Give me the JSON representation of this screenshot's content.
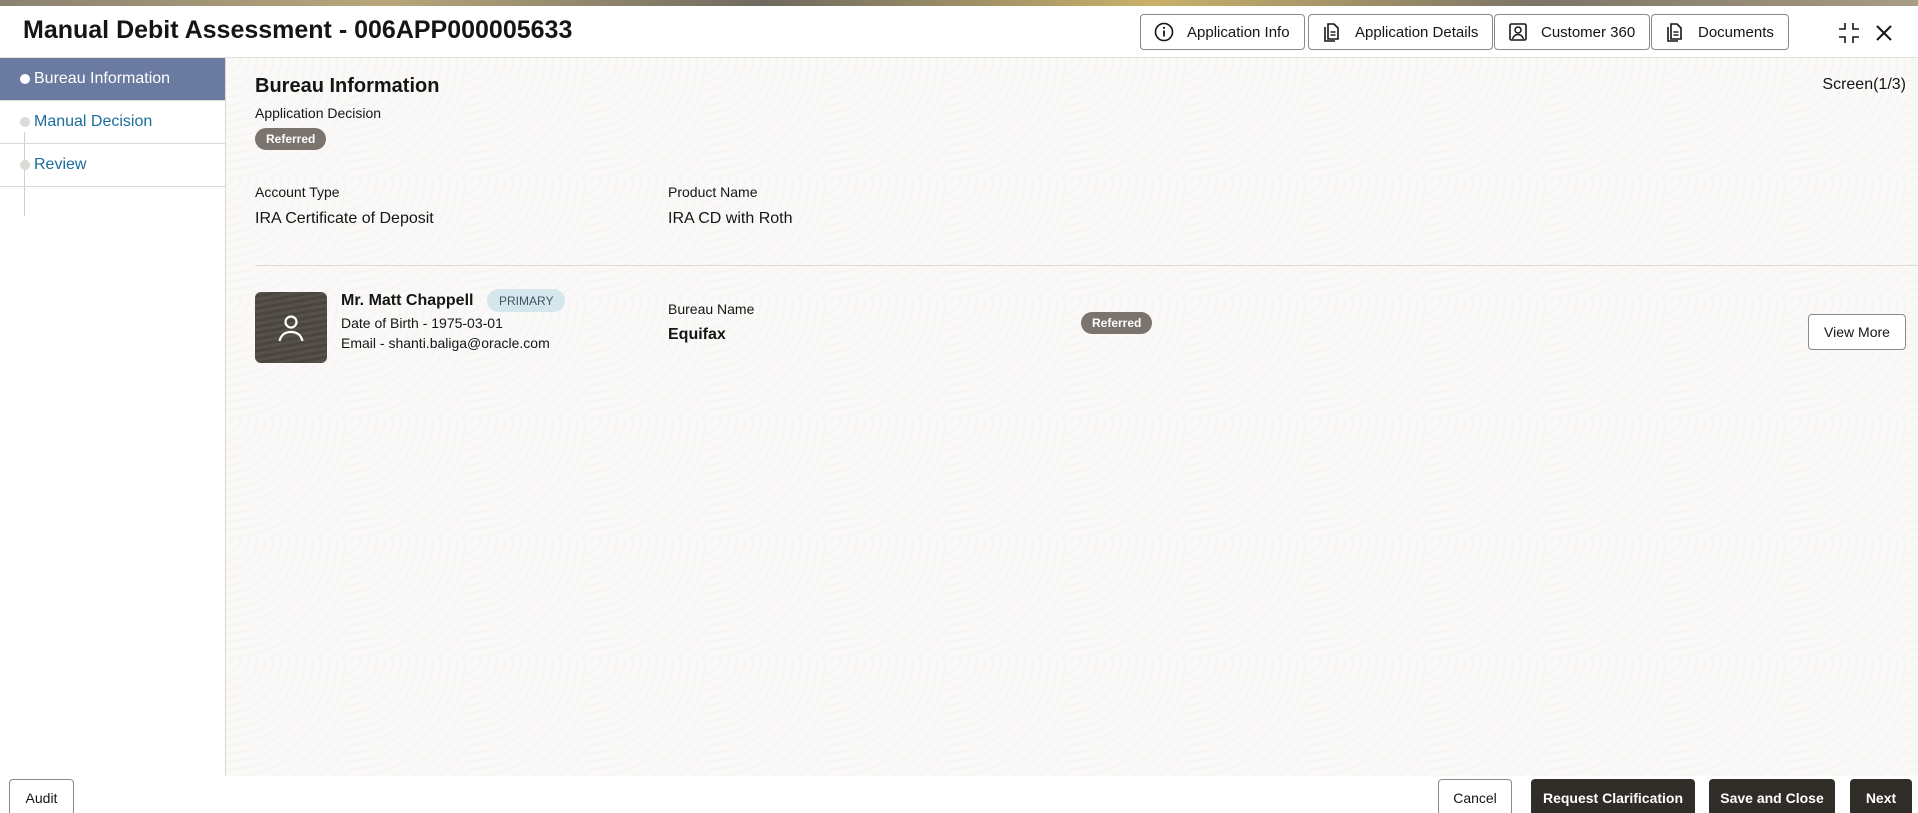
{
  "header": {
    "title": "Manual Debit Assessment - 006APP000005633",
    "buttons": {
      "application_info": "Application Info",
      "application_details": "Application Details",
      "customer_360": "Customer 360",
      "documents": "Documents"
    },
    "icons": [
      "info-icon",
      "document-icon",
      "person-icon",
      "document-icon",
      "collapse-icon",
      "close-icon"
    ]
  },
  "sidebar": {
    "items": [
      {
        "label": "Bureau Information",
        "active": true
      },
      {
        "label": "Manual Decision",
        "active": false
      },
      {
        "label": "Review",
        "active": false
      }
    ]
  },
  "main": {
    "section_title": "Bureau Information",
    "screen_count": "Screen(1/3)",
    "application_decision": {
      "label": "Application Decision",
      "value": "Referred"
    },
    "account_type": {
      "label": "Account Type",
      "value": "IRA Certificate of Deposit"
    },
    "product_name": {
      "label": "Product Name",
      "value": "IRA CD with Roth"
    },
    "applicant": {
      "name": "Mr. Matt Chappell",
      "role_badge": "PRIMARY",
      "dob": "Date of Birth - 1975-03-01",
      "email": "Email - shanti.baliga@oracle.com",
      "bureau_label": "Bureau Name",
      "bureau_value": "Equifax",
      "status": "Referred",
      "view_more": "View More"
    }
  },
  "footer": {
    "audit": "Audit",
    "cancel": "Cancel",
    "request_clarification": "Request Clarification",
    "save_and_close": "Save and Close",
    "next": "Next"
  },
  "colors": {
    "sidebar_active_bg": "#6b7aa1",
    "link": "#1a6d9a",
    "badge_bg": "#7a736e",
    "primary_badge_bg": "#d5e6ec",
    "footer_primary_btn": "#302c28"
  }
}
